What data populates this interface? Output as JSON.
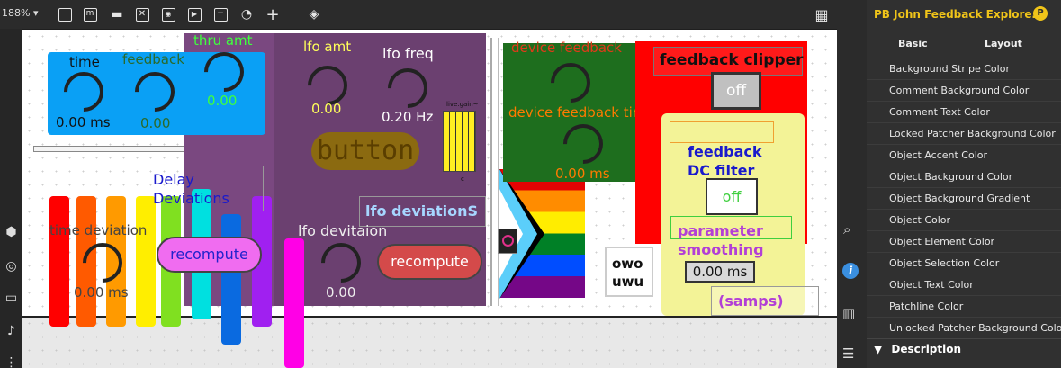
{
  "toolbar": {
    "zoom": "188% ▾",
    "icons": [
      "presentation-icon",
      "message-icon",
      "comment-icon",
      "toggle-icon",
      "number-icon",
      "play-icon",
      "slider-icon",
      "dial-icon",
      "add-icon",
      "paint-bucket-icon",
      "grid-icon"
    ]
  },
  "inspector": {
    "title": "PB John Feedback Explore…",
    "tabs": {
      "basic": "Basic",
      "layout": "Layout"
    },
    "rows": [
      "Background Stripe Color",
      "Comment Background Color",
      "Comment Text Color",
      "Locked Patcher Background Color",
      "Object Accent Color",
      "Object Background Color",
      "Object Background Gradient",
      "Object Color",
      "Object Element Color",
      "Object Selection Color",
      "Object Text Color",
      "Patchline Color",
      "Unlocked Patcher Background Color"
    ],
    "section": "Description"
  },
  "patch": {
    "time_label": "time",
    "feedback_label": "feedback",
    "thru_amt_label": "thru amt",
    "time_value": "0.00 ms",
    "feedback_value": "0.00",
    "thru_value": "0.00",
    "lfo_amt_label": "lfo amt",
    "lfo_amt_value": "0.00",
    "lfo_freq_label": "lfo freq",
    "lfo_freq_value": "0.20 Hz",
    "button_label": "button",
    "gain_label": "live.gain~",
    "gain_c": "c",
    "device_feedback_label": "device feedback",
    "device_feedback_time_label": "device feedback time",
    "device_feedback_time_value": "0.00 ms",
    "feedback_clipper_label": "feedback clipper",
    "clipper_toggle": "off",
    "dc_filter_label": "feedback DC filter",
    "dc_toggle": "off",
    "param_smoothing_label": "parameter smoothing",
    "smoothing_value": "0.00 ms",
    "samps_label": "(samps)",
    "delay_deviations_label": "Delay Deviations",
    "lfo_deviations_label": "lfo deviationS",
    "time_deviation_label": "time deviation",
    "time_deviation_value": "0.00 ms",
    "recompute_1": "recompute",
    "lfo_devitaion_label": "lfo devitaion",
    "lfo_devitaion_value": "0.00",
    "recompute_2": "recompute",
    "owo": "owo",
    "uwu": "uwu"
  },
  "colors": {
    "blue_panel": "#0aa0f5",
    "purple_panel": "#6b4070",
    "green_panel": "#1e6e1e",
    "red_panel": "#ff0000",
    "yellow_panel": "#f3f397"
  }
}
